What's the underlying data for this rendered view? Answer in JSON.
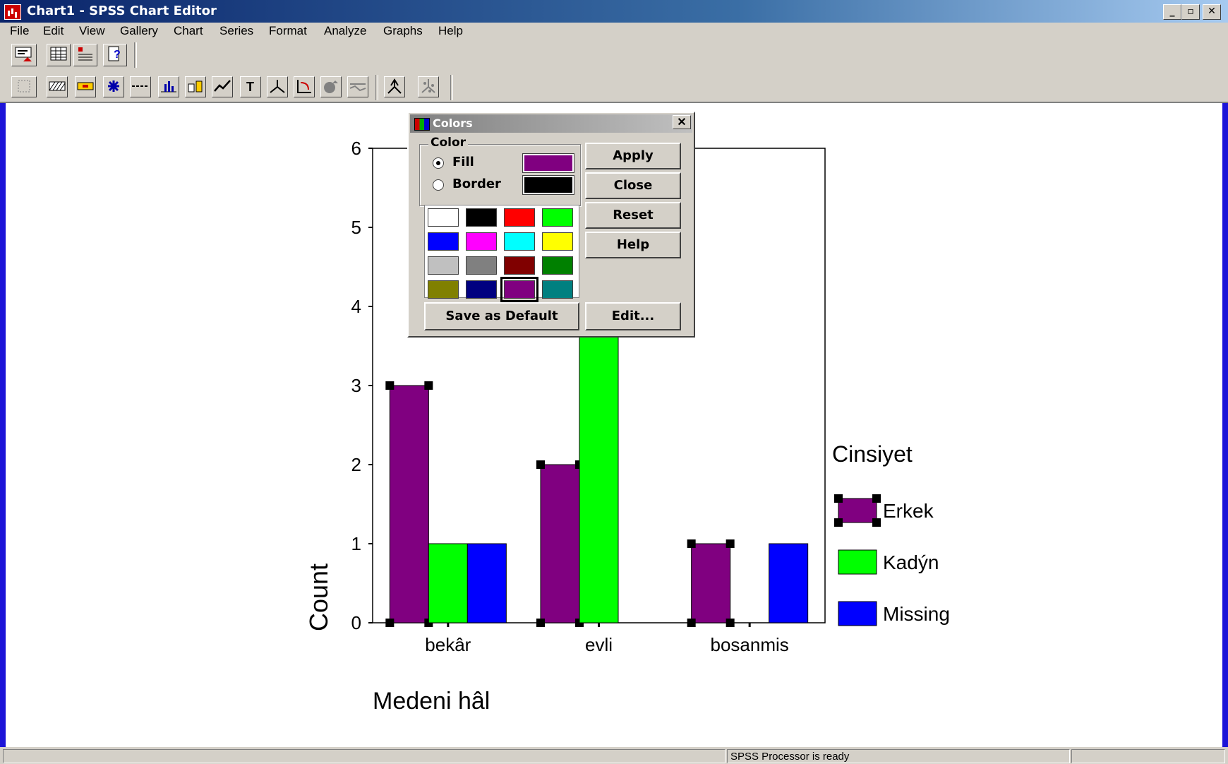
{
  "window": {
    "title": "Chart1 - SPSS Chart Editor"
  },
  "titlebar_buttons": [
    "_",
    "▫",
    "✕"
  ],
  "menu": [
    "File",
    "Edit",
    "View",
    "Gallery",
    "Chart",
    "Series",
    "Format",
    "Analyze",
    "Graphs",
    "Help"
  ],
  "toolbar1_icons": [
    "go-to-data-icon",
    "data-editor-icon",
    "variables-icon",
    "help-icon"
  ],
  "toolbar2_icons": [
    "select-icon",
    "fill-pattern-icon",
    "color-icon",
    "marker-icon",
    "line-style-icon",
    "bar-style-icon",
    "bar-label-icon",
    "interpolation-icon",
    "text-icon",
    "three-d-rotation-icon",
    "swap-axes-icon",
    "explode-slice-icon",
    "break-line-icon",
    "spin-mode-icon",
    "spin-3d-icon"
  ],
  "status": {
    "text": "SPSS Processor  is ready"
  },
  "colors_dialog": {
    "title": "Colors",
    "group_label": "Color",
    "fill_label": "Fill",
    "border_label": "Border",
    "fill_selected": true,
    "fill_color": "#800080",
    "border_color": "#000000",
    "palette": [
      "#ffffff",
      "#000000",
      "#ff0000",
      "#00ff00",
      "#0000ff",
      "#ff00ff",
      "#00ffff",
      "#ffff00",
      "#c0c0c0",
      "#808080",
      "#800000",
      "#008000",
      "#808000",
      "#000080",
      "#800080",
      "#008080"
    ],
    "selected_palette_index": 14,
    "buttons": {
      "apply": "Apply",
      "close": "Close",
      "reset": "Reset",
      "help": "Help",
      "save_default": "Save as Default",
      "edit": "Edit..."
    }
  },
  "chart_data": {
    "type": "bar",
    "categories": [
      "bekâr",
      "evli",
      "bosanmis"
    ],
    "series": [
      {
        "name": "Erkek",
        "values": [
          3,
          2,
          1
        ],
        "color": "#800080"
      },
      {
        "name": "Kadýn",
        "values": [
          1,
          4,
          0
        ],
        "color": "#00ff00"
      },
      {
        "name": "Missing",
        "values": [
          1,
          0,
          1
        ],
        "color": "#0000ff"
      }
    ],
    "ylim": [
      0,
      6
    ],
    "yticks": [
      "0",
      "1",
      "2",
      "3",
      "4",
      "5",
      "6"
    ],
    "xlabel": "Medeni hâl",
    "ylabel": "Count",
    "legend_title": "Cinsiyet",
    "legend_position": "right",
    "selected_series": "Erkek",
    "grid": false
  }
}
